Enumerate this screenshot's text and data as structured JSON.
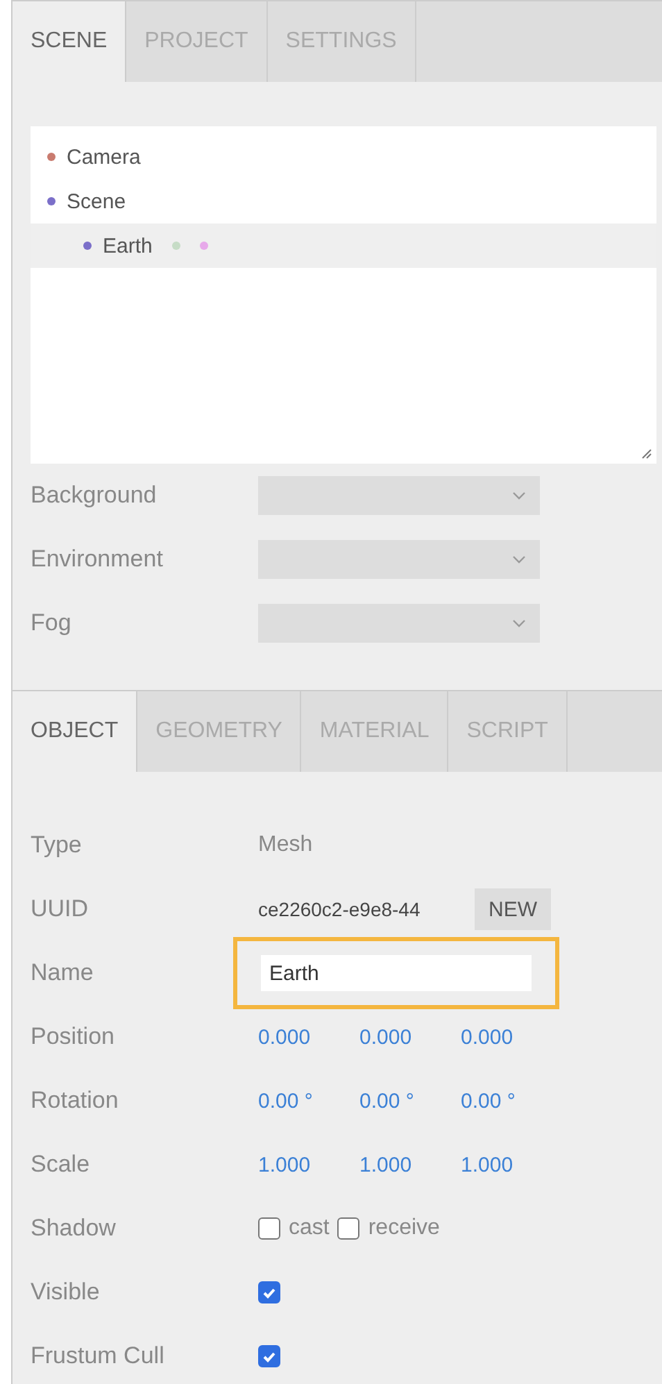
{
  "top_tabs": [
    {
      "label": "SCENE",
      "selected": true
    },
    {
      "label": "PROJECT",
      "selected": false
    },
    {
      "label": "SETTINGS",
      "selected": false
    }
  ],
  "outliner": {
    "items": [
      {
        "label": "Camera",
        "color": "#c97b6f",
        "selected": false
      },
      {
        "label": "Scene",
        "color": "#7b6fc9",
        "selected": false,
        "children": [
          {
            "label": "Earth",
            "color": "#7b6fc9",
            "selected": true,
            "markers": [
              {
                "color": "#c6dcc6"
              },
              {
                "color": "#e7a9ea"
              }
            ]
          }
        ]
      }
    ]
  },
  "scene_fields": [
    {
      "label": "Background"
    },
    {
      "label": "Environment"
    },
    {
      "label": "Fog"
    }
  ],
  "object_tabs": [
    {
      "label": "OBJECT",
      "selected": true
    },
    {
      "label": "GEOMETRY",
      "selected": false
    },
    {
      "label": "MATERIAL",
      "selected": false
    },
    {
      "label": "SCRIPT",
      "selected": false
    }
  ],
  "properties": [
    {
      "kind": "text",
      "label": "Type",
      "value": "Mesh"
    },
    {
      "kind": "uuid",
      "label": "UUID",
      "value": "ce2260c2-e9e8-44",
      "button": "NEW"
    },
    {
      "kind": "input",
      "label": "Name",
      "value": "Earth",
      "highlighted": true
    },
    {
      "kind": "vector",
      "label": "Position",
      "values": [
        "0.000",
        "0.000",
        "0.000"
      ]
    },
    {
      "kind": "vector",
      "label": "Rotation",
      "values": [
        "0.00 °",
        "0.00 °",
        "0.00 °"
      ]
    },
    {
      "kind": "vector",
      "label": "Scale",
      "values": [
        "1.000",
        "1.000",
        "1.000"
      ]
    },
    {
      "kind": "checks",
      "label": "Shadow",
      "options": [
        {
          "label": "cast",
          "checked": false
        },
        {
          "label": "receive",
          "checked": false
        }
      ]
    },
    {
      "kind": "check",
      "label": "Visible",
      "checked": true
    },
    {
      "kind": "check",
      "label": "Frustum Cull",
      "checked": true
    }
  ]
}
